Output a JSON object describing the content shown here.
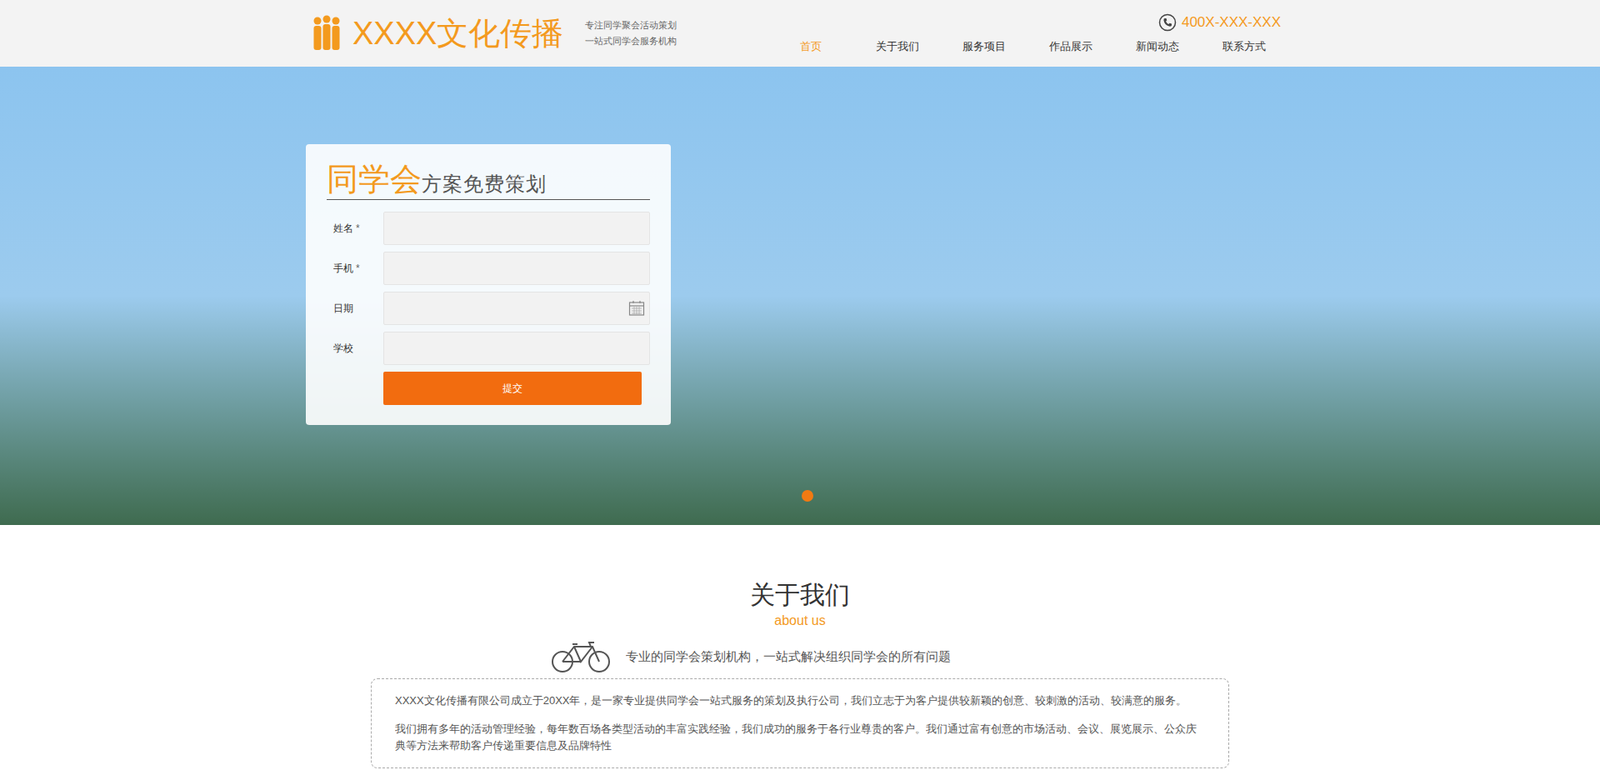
{
  "header": {
    "logo_text": "XXXX文化传播",
    "slogan": [
      "专注同学聚会活动策划",
      "一站式同学会服务机构"
    ],
    "phone": "400X-XXX-XXX"
  },
  "nav": [
    {
      "label": "首页",
      "selected": true
    },
    {
      "label": "关于我们",
      "selected": false
    },
    {
      "label": "服务项目",
      "selected": false
    },
    {
      "label": "作品展示",
      "selected": false
    },
    {
      "label": "新闻动态",
      "selected": false
    },
    {
      "label": "联系方式",
      "selected": false
    }
  ],
  "carousel_dots": [
    {
      "selected": true
    }
  ],
  "form": {
    "title_highlight": "同学会",
    "title_rest": "方案免费策划",
    "required_mark": "*",
    "fields": [
      {
        "label": "姓名",
        "required": true,
        "kind": "text"
      },
      {
        "label": "手机",
        "required": true,
        "kind": "text"
      },
      {
        "label": "日期",
        "required": false,
        "kind": "date"
      },
      {
        "label": "学校",
        "required": false,
        "kind": "text"
      }
    ],
    "submit": "提交"
  },
  "about": {
    "title": "关于我们",
    "subtitle": "about us",
    "tagline": "专业的同学会策划机构，一站式解决组织同学会的所有问题",
    "paragraphs": [
      "XXXX文化传播有限公司成立于20XX年，是一家专业提供同学会一站式服务的策划及执行公司，我们立志于为客户提供较新颖的创意、较刺激的活动、较满意的服务。",
      "我们拥有多年的活动管理经验，每年数百场各类型活动的丰富实践经验，我们成功的服务于各行业尊贵的客户。我们通过富有创意的市场活动、会议、展览展示、公众庆典等方法来帮助客户传递重要信息及品牌特性"
    ]
  }
}
